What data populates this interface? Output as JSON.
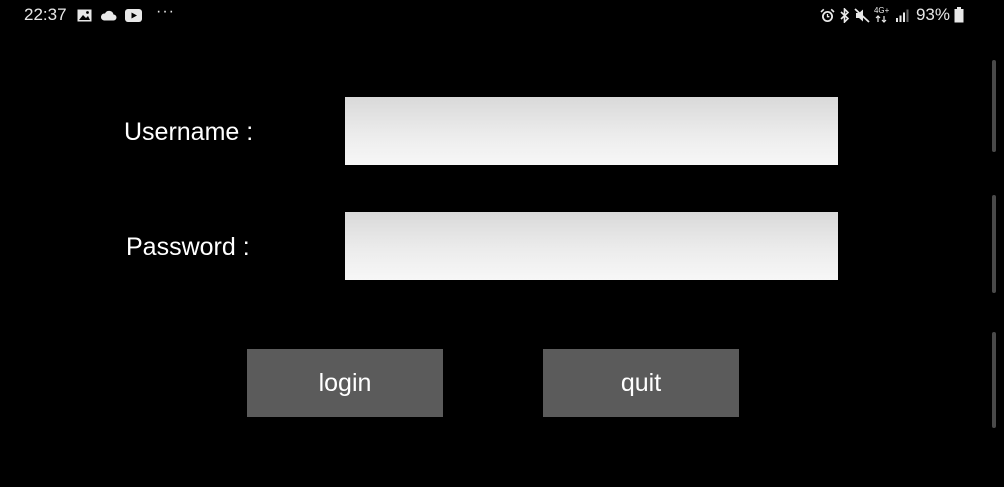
{
  "status_bar": {
    "time": "22:37",
    "more": "···",
    "network": "4G+",
    "battery": "93%",
    "left_icons": [
      "gallery-icon",
      "cloud-icon",
      "youtube-icon"
    ],
    "right_icons": [
      "alarm-icon",
      "bluetooth-icon",
      "mute-icon",
      "signal-icon",
      "battery-icon"
    ]
  },
  "form": {
    "username_label": "Username :",
    "password_label": "Password :",
    "username_value": "",
    "password_value": ""
  },
  "buttons": {
    "login": "login",
    "quit": "quit"
  },
  "colors": {
    "background": "#000000",
    "button": "#5b5b5b",
    "text": "#ffffff"
  }
}
